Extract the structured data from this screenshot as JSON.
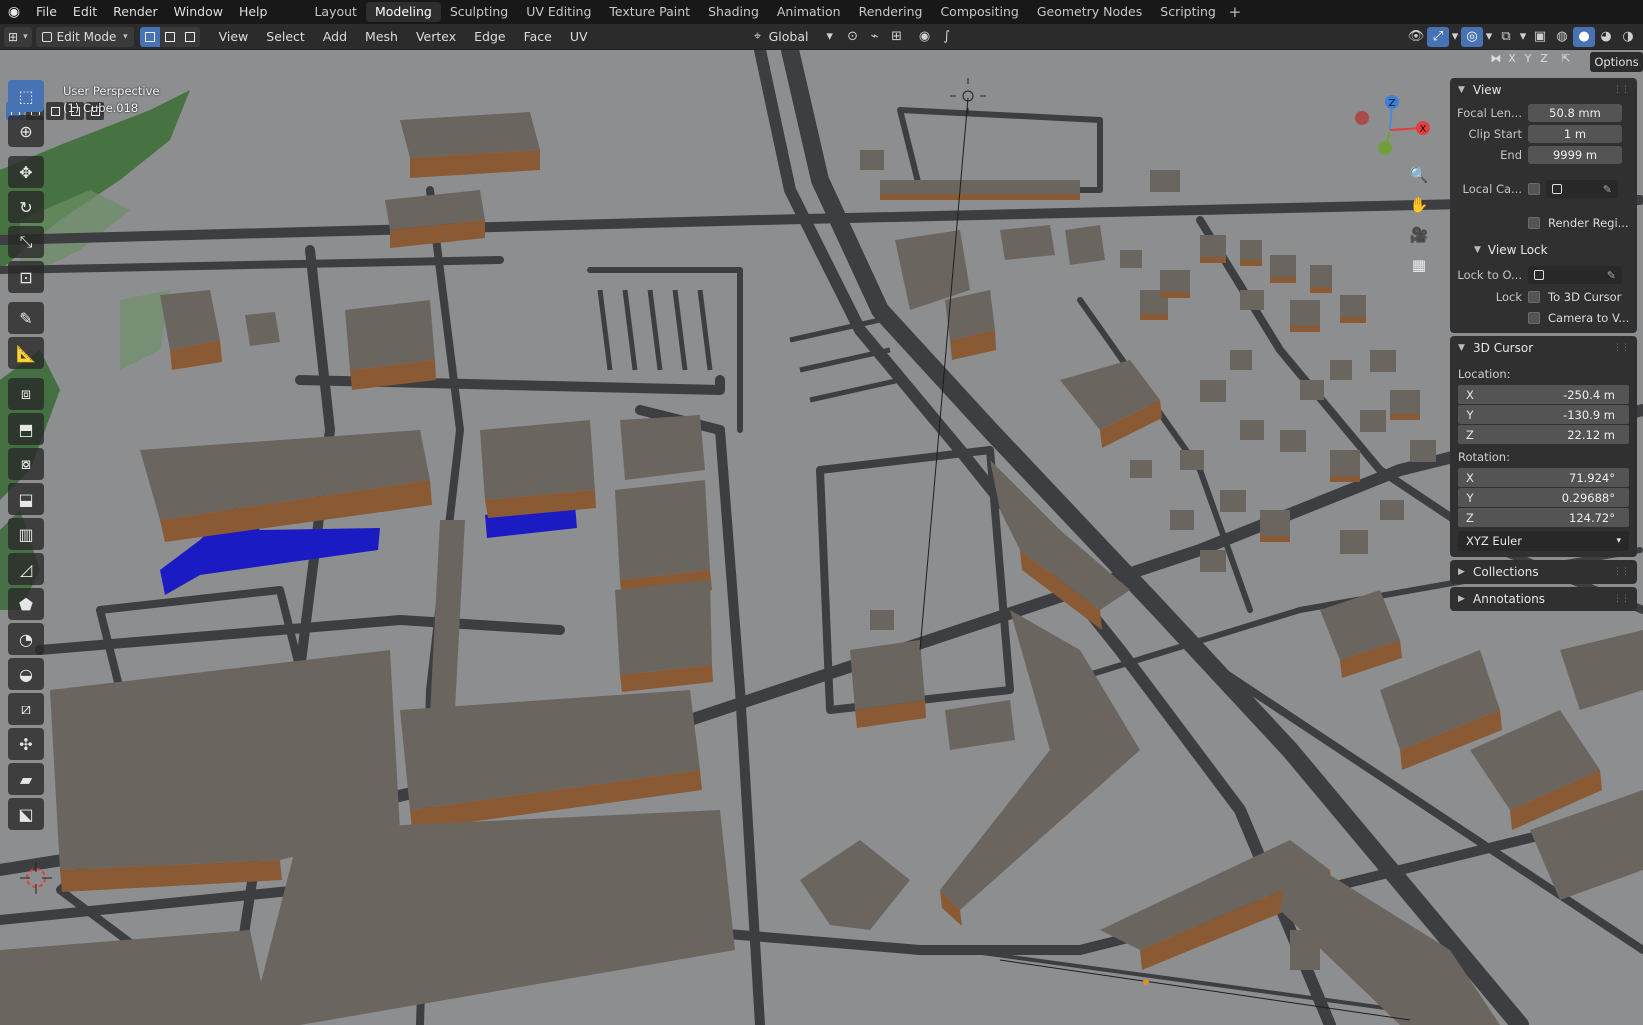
{
  "app": {
    "menu": [
      "File",
      "Edit",
      "Render",
      "Window",
      "Help"
    ],
    "workspaces": [
      "Layout",
      "Modeling",
      "Sculpting",
      "UV Editing",
      "Texture Paint",
      "Shading",
      "Animation",
      "Rendering",
      "Compositing",
      "Geometry Nodes",
      "Scripting"
    ],
    "active_workspace": "Modeling",
    "add_workspace": "+"
  },
  "header": {
    "mode": "Edit Mode",
    "menus": [
      "View",
      "Select",
      "Add",
      "Mesh",
      "Vertex",
      "Edge",
      "Face",
      "UV"
    ],
    "transform_orientation": "Global"
  },
  "viewport": {
    "perspective": "User Perspective",
    "object": "(1) Cube.018",
    "axes": [
      "X",
      "Y",
      "Z"
    ],
    "options_label": "Options",
    "gizmo": {
      "z": "Z",
      "x": "X"
    }
  },
  "npanel": {
    "view": {
      "title": "View",
      "focal_length_label": "Focal Len...",
      "focal_length": "50.8 mm",
      "clip_start_label": "Clip Start",
      "clip_start": "1 m",
      "end_label": "End",
      "end": "9999 m",
      "local_camera_label": "Local Ca...",
      "render_region_label": "Render Regi...",
      "view_lock_title": "View Lock",
      "lock_to_object_label": "Lock to O...",
      "lock_label": "Lock",
      "lock_to_cursor": "To 3D Cursor",
      "camera_to_view": "Camera to V..."
    },
    "cursor": {
      "title": "3D Cursor",
      "location_label": "Location:",
      "loc_x": "-250.4 m",
      "loc_y": "-130.9 m",
      "loc_z": "22.12 m",
      "rotation_label": "Rotation:",
      "rot_x": "71.924°",
      "rot_y": "0.29688°",
      "rot_z": "124.72°",
      "rotation_mode": "XYZ Euler"
    },
    "collections_title": "Collections",
    "annotations_title": "Annotations"
  },
  "colors": {
    "ground": "#8d8e90",
    "road": "#3f4043",
    "roof": "#6b6560",
    "wall": "#8a5a34",
    "water": "#1b1bc4",
    "accent": "#4772b3"
  }
}
